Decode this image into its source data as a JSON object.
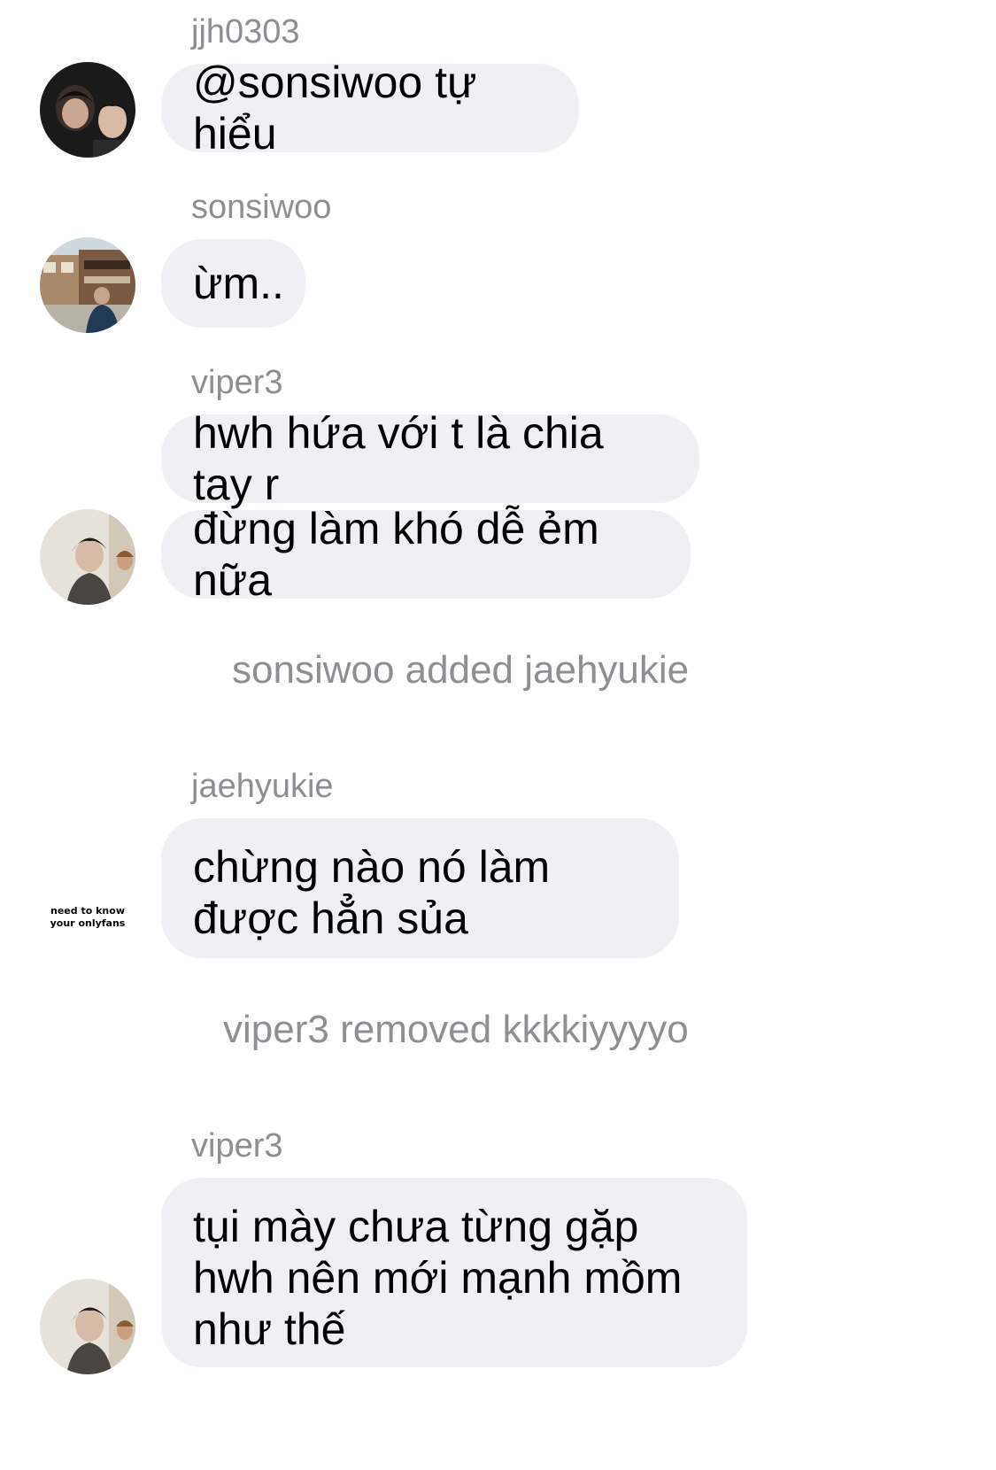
{
  "messages": [
    {
      "sender": "jjh0303",
      "texts": [
        "@sonsiwoo tự hiểu"
      ]
    },
    {
      "sender": "sonsiwoo",
      "texts": [
        "ừm.."
      ]
    },
    {
      "sender": "viper3",
      "texts": [
        "hwh hứa với t là chia tay r",
        "đừng làm khó dễ ẻm nữa"
      ]
    },
    {
      "sender": "jaehyukie",
      "texts": [
        "chừng nào nó làm được hẳn sủa"
      ]
    },
    {
      "sender": "viper3",
      "texts": [
        "tụi mày chưa từng gặp hwh nên mới mạnh mồm như thế"
      ]
    }
  ],
  "system": [
    "sonsiwoo added jaehyukie",
    "viper3 removed kkkkiyyyyo"
  ],
  "avatars": {
    "jaehyukie_line1": "need to know",
    "jaehyukie_line2": "your onlyfans"
  },
  "colors": {
    "bubble": "#efeff4",
    "secondary_text": "#8e8e93",
    "background": "#ffffff"
  }
}
